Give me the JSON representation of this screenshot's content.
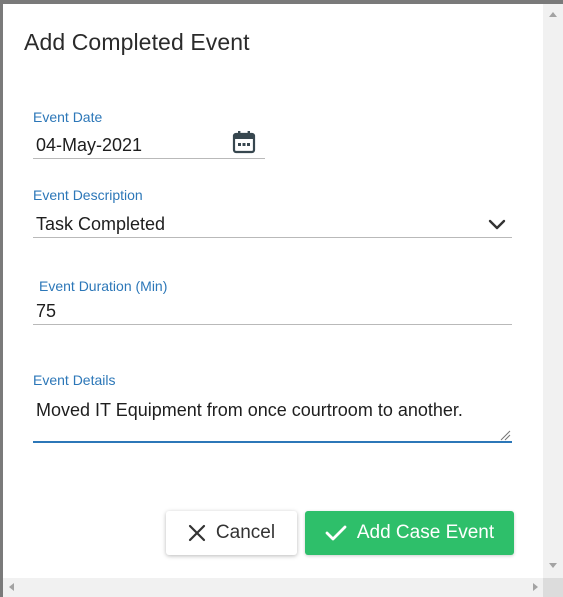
{
  "dialog": {
    "title": "Add Completed Event"
  },
  "form": {
    "event_date": {
      "label": "Event Date",
      "value": "04-May-2021"
    },
    "event_description": {
      "label": "Event Description",
      "value": "Task Completed"
    },
    "event_duration": {
      "label": "Event Duration (Min)",
      "value": "75"
    },
    "event_details": {
      "label": "Event Details",
      "value": "Moved IT Equipment from once courtroom to another."
    }
  },
  "buttons": {
    "cancel_label": "Cancel",
    "add_label": "Add Case Event"
  },
  "icons": {
    "calendar": "calendar-icon",
    "dropdown": "chevron-down-icon",
    "cancel": "close-icon",
    "add": "check-icon"
  },
  "colors": {
    "accent": "#2c77b8",
    "primary_button": "#2ebf6a",
    "overlay": "#7a7a7a"
  }
}
